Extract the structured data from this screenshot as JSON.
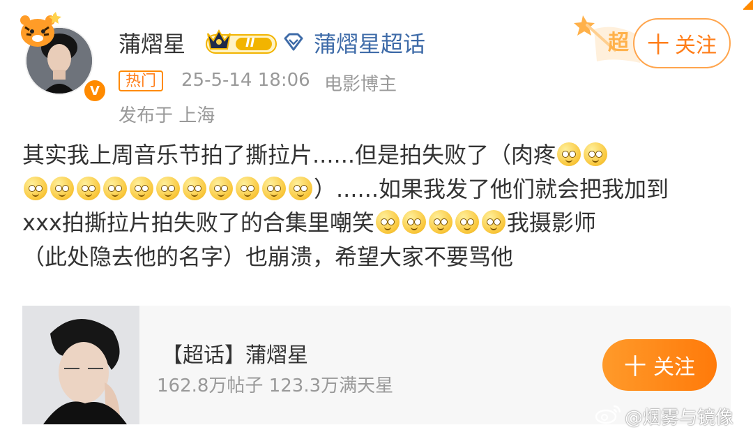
{
  "header": {
    "username": "蒲熠星",
    "level_badge": "II",
    "topic_link": "蒲熠星超话",
    "chaohua_badge": "超",
    "follow_label": "关注",
    "follow_plus": "十",
    "hot_tag": "热门",
    "timestamp": "25-5-14 18:06",
    "role": "电影博主",
    "location": "发布于 上海",
    "verified_badge": "V"
  },
  "post": {
    "lines": [
      [
        "其实我上周音乐节拍了撕拉片......但是拍失败了（肉疼",
        2,
        ""
      ],
      [
        "",
        11,
        "）......如果我发了他们就会把我加到"
      ],
      [
        "xxx拍撕拉片拍失败了的合集里嘲笑",
        5,
        "我摄影师"
      ],
      [
        "（此处隐去他的名字）也崩溃，希望大家不要骂他",
        0,
        ""
      ]
    ],
    "emoji_name": "laughing-tears-emoji"
  },
  "topic_card": {
    "title": "【超话】蒲熠星",
    "stats": "162.8万帖子 123.3万满天星",
    "follow_label": "关注",
    "follow_plus": "十"
  },
  "watermark": {
    "text": "@烟雾与镜像"
  },
  "colors": {
    "accent_orange": "#ff7e1a",
    "link_blue": "#3e6ba8",
    "meta_gray": "#999999",
    "card_bg": "#f7f7f7"
  },
  "icons": [
    "tiger-badge-icon",
    "crown-level-badge-icon",
    "diamond-icon",
    "chaohua-badge-icon",
    "verified-v-icon",
    "weibo-logo-icon"
  ]
}
